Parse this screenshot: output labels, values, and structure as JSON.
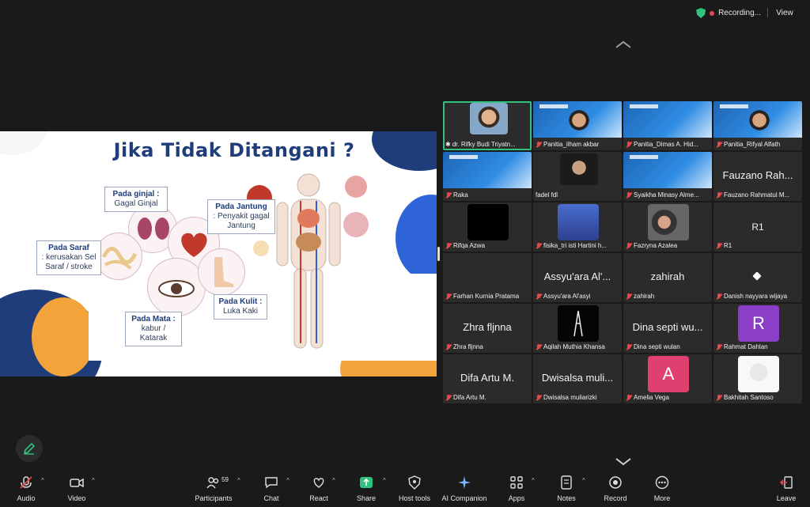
{
  "topbar": {
    "recording_label": "Recording...",
    "view_label": "View"
  },
  "slide": {
    "title": "Jika Tidak Ditangani ?",
    "callouts": [
      {
        "head": "Pada ginjal :",
        "body": "Gagal Ginjal"
      },
      {
        "head": "Pada Jantung",
        "body": ": Penyakit gagal Jantung"
      },
      {
        "head": "Pada Saraf",
        "body": ": kerusakan Sel Saraf / stroke"
      },
      {
        "head": "Pada Kulit :",
        "body": "Luka Kaki"
      },
      {
        "head": "Pada Mata :",
        "body": "kabur / Katarak"
      }
    ]
  },
  "participants": [
    {
      "name": "dr. Rifky Budi Triyatn...",
      "display": ""
    },
    {
      "name": "Panitia_ilham akbar",
      "display": ""
    },
    {
      "name": "Panitia_Dimas A. Hid...",
      "display": ""
    },
    {
      "name": "Panitia_Rifyal Alfath",
      "display": ""
    },
    {
      "name": "Raka",
      "display": ""
    },
    {
      "name": "fadel fdl",
      "display": ""
    },
    {
      "name": "Syaikha Minasy Alme...",
      "display": ""
    },
    {
      "name": "Fauzano Rahmatul M...",
      "display": "Fauzano Rah..."
    },
    {
      "name": "Rifqa Azwa",
      "display": ""
    },
    {
      "name": "fisika_tri isti Hartini h...",
      "display": ""
    },
    {
      "name": "Fazryna Azalea",
      "display": ""
    },
    {
      "name": "R1",
      "display": "R1"
    },
    {
      "name": "Farhan Kurnia Pratama",
      "display": ""
    },
    {
      "name": "Assyu'ara Al'asyi",
      "display": "Assyu'ara Al'..."
    },
    {
      "name": "zahirah",
      "display": "zahirah"
    },
    {
      "name": "Danish nayyara wijaya",
      "display": ""
    },
    {
      "name": "Zhra fljnna",
      "display": "Zhra fljnna"
    },
    {
      "name": "Aqilah Muthia Khansa",
      "display": ""
    },
    {
      "name": "Dina septi wulan",
      "display": "Dina septi wu..."
    },
    {
      "name": "Rahmat Dahlan",
      "display": ""
    },
    {
      "name": "Difa Artu M.",
      "display": "Difa Artu M."
    },
    {
      "name": "Dwisalsa muliarizki",
      "display": "Dwisalsa muli..."
    },
    {
      "name": "Amelia Vega",
      "display": ""
    },
    {
      "name": "Bakhitah Santoso",
      "display": ""
    }
  ],
  "avatars": {
    "rahmat_initial": "R",
    "amelia_initial": "A",
    "rahmat_color": "#8b3fc7",
    "amelia_color": "#e0406f"
  },
  "toolbar": {
    "audio": "Audio",
    "video": "Video",
    "participants": "Participants",
    "participants_count": "59",
    "chat": "Chat",
    "react": "React",
    "share": "Share",
    "host_tools": "Host tools",
    "ai_companion": "AI Companion",
    "apps": "Apps",
    "notes": "Notes",
    "record": "Record",
    "more": "More",
    "leave": "Leave"
  }
}
